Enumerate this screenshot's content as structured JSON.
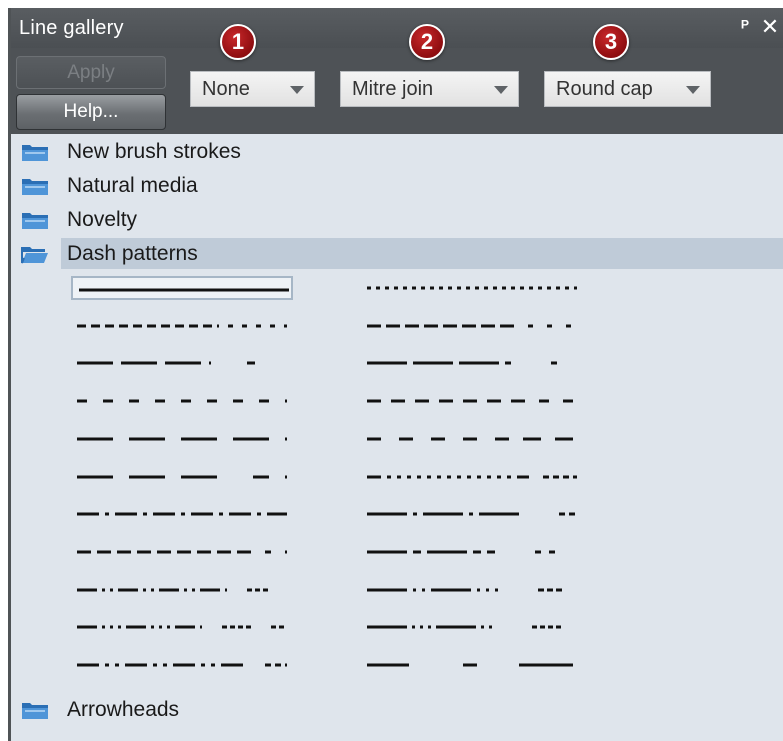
{
  "panel": {
    "title": "Line gallery",
    "pin_icon": "pin-icon",
    "close_icon": "close-icon"
  },
  "toolbar": {
    "apply_label": "Apply",
    "help_label": "Help...",
    "dropdowns": [
      {
        "value": "None",
        "badge": "1"
      },
      {
        "value": "Mitre join",
        "badge": "2"
      },
      {
        "value": "Round cap",
        "badge": "3"
      }
    ]
  },
  "folders": [
    {
      "label": "New brush strokes",
      "icon": "folder-icon",
      "selected": false
    },
    {
      "label": "Natural media",
      "icon": "folder-icon",
      "selected": false
    },
    {
      "label": "Novelty",
      "icon": "folder-icon",
      "selected": false
    },
    {
      "label": "Dash patterns",
      "icon": "folder-open-icon",
      "selected": true
    },
    {
      "label": "Arrowheads",
      "icon": "folder-icon",
      "selected": false
    }
  ],
  "dash_patterns": {
    "left": [
      [
        1
      ],
      [
        9,
        5,
        9,
        5,
        9,
        5,
        9,
        5,
        9,
        5,
        9,
        5,
        9,
        5,
        9,
        5,
        9,
        5,
        9,
        5,
        2
      ],
      [
        36,
        8,
        36,
        8,
        36,
        8,
        2
      ],
      [
        10,
        16,
        10,
        16,
        10,
        16,
        10,
        16,
        10,
        16,
        10,
        16,
        10,
        16,
        10,
        16
      ],
      [
        36,
        16,
        36,
        16,
        36,
        16
      ],
      [
        36,
        16,
        36,
        16,
        36,
        36,
        16,
        16
      ],
      [
        22,
        6,
        4,
        6,
        22,
        6,
        4,
        6,
        22,
        6,
        4,
        6,
        22,
        6,
        4,
        6
      ],
      [
        14,
        6,
        14,
        6,
        14,
        6,
        14,
        6,
        14,
        6,
        14,
        6,
        14,
        6,
        14,
        6,
        14
      ],
      [
        20,
        5,
        3,
        5,
        3,
        5,
        20,
        5,
        3,
        5,
        3,
        5,
        20,
        5,
        3,
        5,
        3,
        5,
        20,
        5,
        2
      ],
      [
        20,
        5,
        3,
        5,
        3,
        5,
        3,
        5,
        20,
        5,
        3,
        5,
        3,
        5,
        3,
        5,
        20,
        5,
        2
      ],
      [
        22,
        6,
        4,
        6,
        4,
        6,
        22,
        6,
        4,
        6,
        4,
        6,
        22,
        6,
        4,
        6,
        4,
        6,
        22
      ]
    ],
    "right": [
      [
        4,
        5
      ],
      [
        14,
        5,
        14,
        5,
        14,
        5,
        14,
        5,
        14,
        5,
        14,
        5,
        14,
        5,
        14
      ],
      [
        40,
        6,
        40,
        6,
        40,
        6,
        6
      ],
      [
        14,
        10,
        14,
        10,
        14,
        10,
        14,
        10,
        14,
        10,
        14,
        10,
        14
      ],
      [
        14,
        18,
        14,
        18,
        14,
        18,
        14,
        18,
        14
      ],
      [
        14,
        6,
        4,
        6,
        4,
        6,
        4,
        6,
        4,
        6,
        4,
        6,
        4,
        6,
        4,
        6,
        4,
        6,
        4,
        6,
        4,
        6,
        4,
        6,
        4,
        6,
        4,
        6,
        12
      ],
      [
        40,
        6,
        4,
        6,
        40,
        6,
        4,
        6,
        40
      ],
      [
        40,
        6,
        8,
        6,
        40,
        6,
        8,
        6,
        8
      ],
      [
        40,
        6,
        3,
        6,
        3,
        6,
        40,
        6,
        3,
        6,
        3,
        6,
        3
      ],
      [
        40,
        5,
        3,
        5,
        3,
        5,
        3,
        5,
        40,
        5,
        3,
        5,
        3
      ],
      [
        42,
        54,
        14
      ]
    ]
  }
}
